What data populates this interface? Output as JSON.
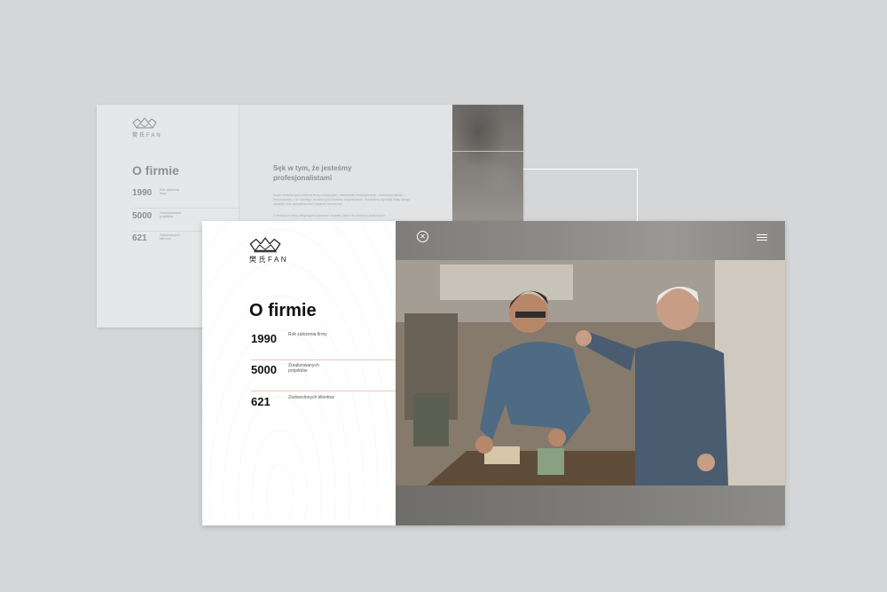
{
  "brand": {
    "logo_text": "樊氏FAN"
  },
  "back_page": {
    "title": "O firmie",
    "stats": [
      {
        "number": "1990",
        "label": "Rok założenia firmy"
      },
      {
        "number": "5000",
        "label": "Zrealizowanych projektów"
      },
      {
        "number": "621",
        "label": "Zadowolonych klientów"
      }
    ],
    "headline": "Sęk w tym, że jesteśmy profesjonalistami",
    "paragraph_1": "Studio Drewna jest rodzinną firmą o tradycjach i wieloletnim doświadczeniu. Gwarancja jakości i terminowości, a do każdego zlecenia podchodzimy indywidualnie. Posiadamy wysokiej klasy sprzęt stolarski oraz specjalistyczne zaplecze techniczne.",
    "paragraph_2": "Z bieżących usług decydujące poprawne zadania, także dla instytucji publicznych."
  },
  "front_page": {
    "title": "O firmie",
    "stats": [
      {
        "number": "1990",
        "label": "Rok założenia firmy"
      },
      {
        "number": "5000",
        "label": "Zrealizowanych projektów"
      },
      {
        "number": "621",
        "label": "Zadowolonych klientów"
      }
    ],
    "close_symbol": "✕",
    "icons": {
      "close": "close-icon",
      "menu": "hamburger-menu-icon"
    }
  },
  "colors": {
    "background": "#d5d6d8",
    "accent_divider": "#e8cbb5",
    "text_dark": "#111111"
  }
}
